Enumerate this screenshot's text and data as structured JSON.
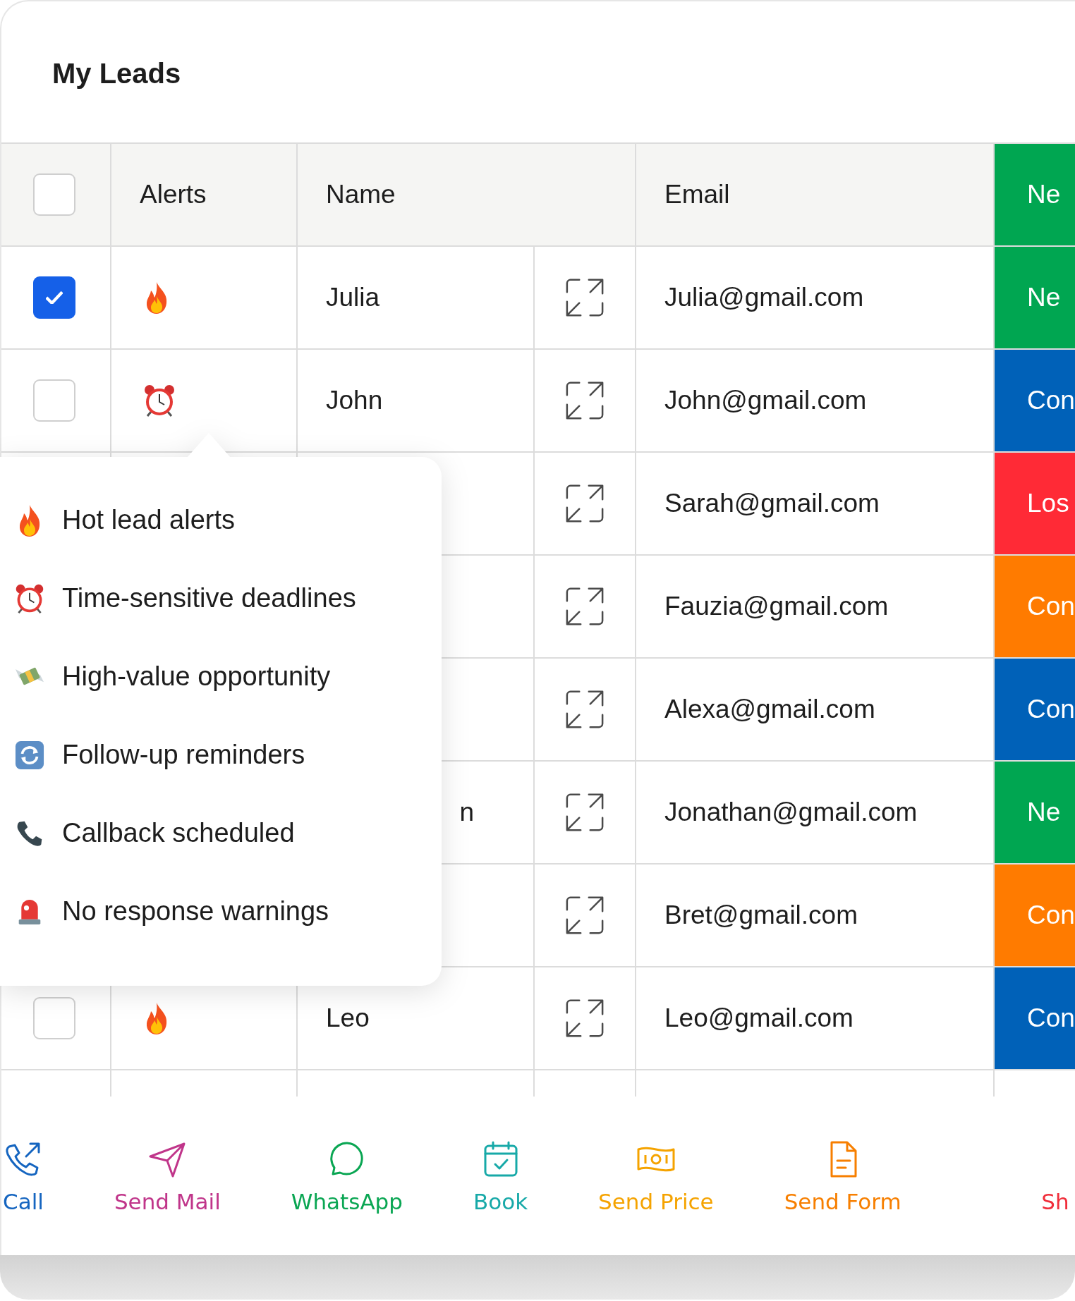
{
  "title": "My Leads",
  "table": {
    "select_all": {
      "checked": false
    },
    "columns": [
      "Alerts",
      "Name",
      "Email"
    ],
    "status_header": {
      "text": "Ne",
      "color": "#00a651"
    },
    "rows": [
      {
        "checked": true,
        "kind": "fire",
        "name": "Julia",
        "email": "Julia@gmail.com",
        "status": "Ne",
        "color": "#00a651"
      },
      {
        "checked": false,
        "kind": "clock",
        "name": "John",
        "email": "John@gmail.com",
        "status": "Con",
        "color": "#0061b8"
      },
      {
        "email": "Sarah@gmail.com",
        "status": "Los",
        "color": "#ff2a36"
      },
      {
        "email": "Fauzia@gmail.com",
        "status": "Con",
        "color": "#ff7b00"
      },
      {
        "email": "Alexa@gmail.com",
        "status": "Con",
        "color": "#0061b8"
      },
      {
        "name": "n",
        "email": "Jonathan@gmail.com",
        "status": "Ne",
        "color": "#00a651"
      },
      {
        "email": "Bret@gmail.com",
        "status": "Con",
        "color": "#ff7b00"
      },
      {
        "checked": false,
        "kind": "fire",
        "name": "Leo",
        "email": "Leo@gmail.com",
        "status": "Con",
        "color": "#0061b8"
      }
    ]
  },
  "alerts_menu": [
    {
      "kind": "fire",
      "label": "Hot lead alerts"
    },
    {
      "kind": "clock",
      "label": "Time-sensitive deadlines"
    },
    {
      "kind": "money",
      "label": "High-value opportunity"
    },
    {
      "kind": "refresh",
      "label": "Follow-up reminders"
    },
    {
      "kind": "phone",
      "label": "Callback scheduled"
    },
    {
      "kind": "siren",
      "label": "No response warnings"
    }
  ],
  "actions": [
    {
      "kind": "call",
      "label": "Call",
      "color": "#1565c0"
    },
    {
      "kind": "mail",
      "label": "Send Mail",
      "color": "#c0358a"
    },
    {
      "kind": "chat",
      "label": "WhatsApp",
      "color": "#0aa653"
    },
    {
      "kind": "calendar",
      "label": "Book",
      "color": "#17a9a8"
    },
    {
      "kind": "price",
      "label": "Send Price",
      "color": "#f5a300"
    },
    {
      "kind": "form",
      "label": "Send Form",
      "color": "#f77f00"
    },
    {
      "label": "Sh",
      "color": "#f02d3a"
    }
  ]
}
